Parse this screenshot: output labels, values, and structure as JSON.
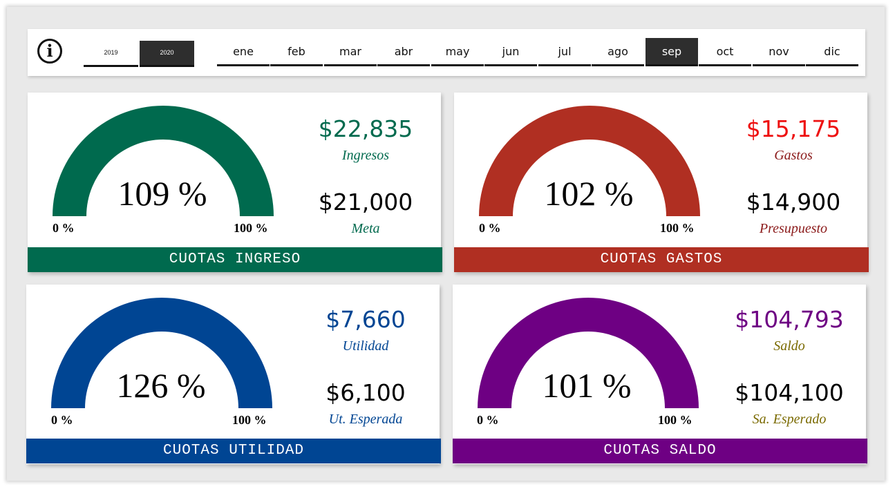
{
  "info_icon": "i",
  "years": [
    "2019",
    "2020"
  ],
  "active_year": "2020",
  "months": [
    "ene",
    "feb",
    "mar",
    "abr",
    "may",
    "jun",
    "jul",
    "ago",
    "sep",
    "oct",
    "nov",
    "dic"
  ],
  "active_month": "sep",
  "cards": [
    {
      "title": "CUOTAS INGRESO",
      "percent": "109 %",
      "percent_value": 109,
      "min_label": "0 %",
      "max_label": "100 %",
      "actual": "$22,835",
      "actual_label": "Ingresos",
      "target": "$21,000",
      "target_label": "Meta",
      "color": "#006a4e",
      "actual_color": "#006a4e",
      "label_color": "#006a4e"
    },
    {
      "title": "CUOTAS GASTOS",
      "percent": "102 %",
      "percent_value": 102,
      "min_label": "0 %",
      "max_label": "100 %",
      "actual": "$15,175",
      "actual_label": "Gastos",
      "target": "$14,900",
      "target_label": "Presupuesto",
      "color": "#b02f22",
      "actual_color": "#ee1111",
      "label_color": "#8b1a1a"
    },
    {
      "title": "CUOTAS UTILIDAD",
      "percent": "126 %",
      "percent_value": 126,
      "min_label": "0 %",
      "max_label": "100 %",
      "actual": "$7,660",
      "actual_label": "Utilidad",
      "target": "$6,100",
      "target_label": "Ut. Esperada",
      "color": "#004593",
      "actual_color": "#004593",
      "label_color": "#004593"
    },
    {
      "title": "CUOTAS SALDO",
      "percent": "101 %",
      "percent_value": 101,
      "min_label": "0 %",
      "max_label": "100 %",
      "actual": "$104,793",
      "actual_label": "Saldo",
      "target": "$104,100",
      "target_label": "Sa. Esperado",
      "color": "#6e0083",
      "actual_color": "#6e0083",
      "label_color": "#7a6a00"
    }
  ]
}
